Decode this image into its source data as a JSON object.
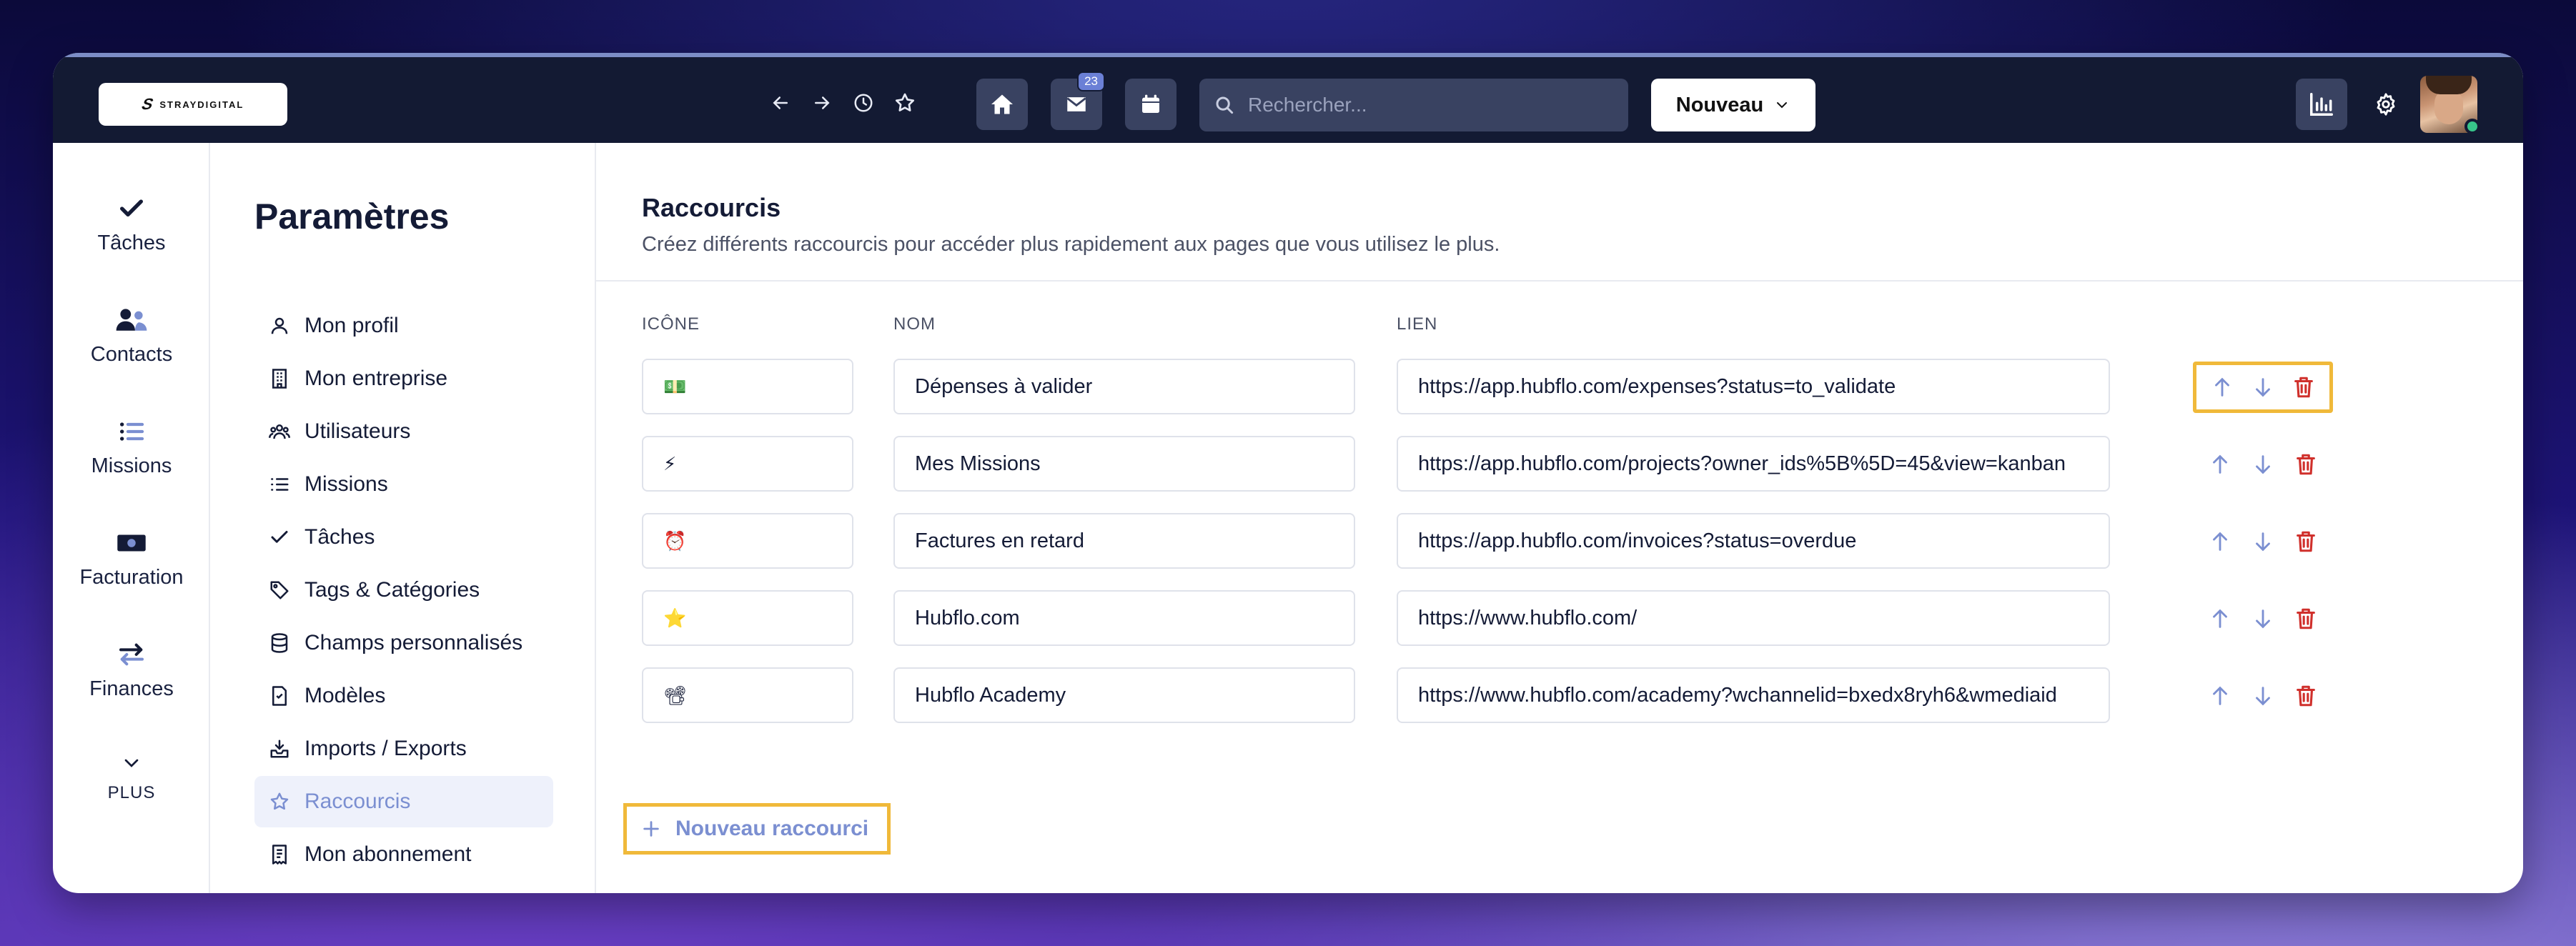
{
  "topbar": {
    "logo_text": "STRAYDIGITAL",
    "mail_badge": "23",
    "search_placeholder": "Rechercher...",
    "new_button_label": "Nouveau"
  },
  "rail": {
    "items": [
      {
        "label": "Tâches",
        "icon": "check-icon"
      },
      {
        "label": "Contacts",
        "icon": "contacts-icon"
      },
      {
        "label": "Missions",
        "icon": "list-icon"
      },
      {
        "label": "Facturation",
        "icon": "banknote-icon"
      },
      {
        "label": "Finances",
        "icon": "transfer-icon"
      }
    ],
    "more_label": "PLUS"
  },
  "settings_menu": {
    "title": "Paramètres",
    "items": [
      {
        "label": "Mon profil",
        "icon": "user-icon"
      },
      {
        "label": "Mon entreprise",
        "icon": "building-icon"
      },
      {
        "label": "Utilisateurs",
        "icon": "users-icon"
      },
      {
        "label": "Missions",
        "icon": "list-icon"
      },
      {
        "label": "Tâches",
        "icon": "check-icon"
      },
      {
        "label": "Tags & Catégories",
        "icon": "tags-icon"
      },
      {
        "label": "Champs personnalisés",
        "icon": "database-icon"
      },
      {
        "label": "Modèles",
        "icon": "document-icon"
      },
      {
        "label": "Imports / Exports",
        "icon": "inbox-icon"
      },
      {
        "label": "Raccourcis",
        "icon": "star-icon",
        "active": true
      },
      {
        "label": "Mon abonnement",
        "icon": "receipt-icon"
      }
    ]
  },
  "main": {
    "title": "Raccourcis",
    "description": "Créez différents raccourcis pour accéder plus rapidement aux pages que vous utilisez le plus.",
    "columns": {
      "icon": "ICÔNE",
      "name": "NOM",
      "link": "LIEN"
    },
    "rows": [
      {
        "emoji": "💵",
        "name": "Dépenses à valider",
        "link": "https://app.hubflo.com/expenses?status=to_validate"
      },
      {
        "emoji": "⚡",
        "name": "Mes Missions",
        "link": "https://app.hubflo.com/projects?owner_ids%5B%5D=45&view=kanban"
      },
      {
        "emoji": "⏰",
        "name": "Factures en retard",
        "link": "https://app.hubflo.com/invoices?status=overdue"
      },
      {
        "emoji": "⭐",
        "name": "Hubflo.com",
        "link": "https://www.hubflo.com/"
      },
      {
        "emoji": "📽",
        "name": "Hubflo Academy",
        "link": "https://www.hubflo.com/academy?wchannelid=bxedx8ryh6&wmediaid"
      }
    ],
    "add_label": "Nouveau raccourci"
  },
  "colors": {
    "topbar": "#131a33",
    "accent": "#7b8fd1",
    "highlight": "#f0b93a",
    "delete": "#d0302c"
  }
}
